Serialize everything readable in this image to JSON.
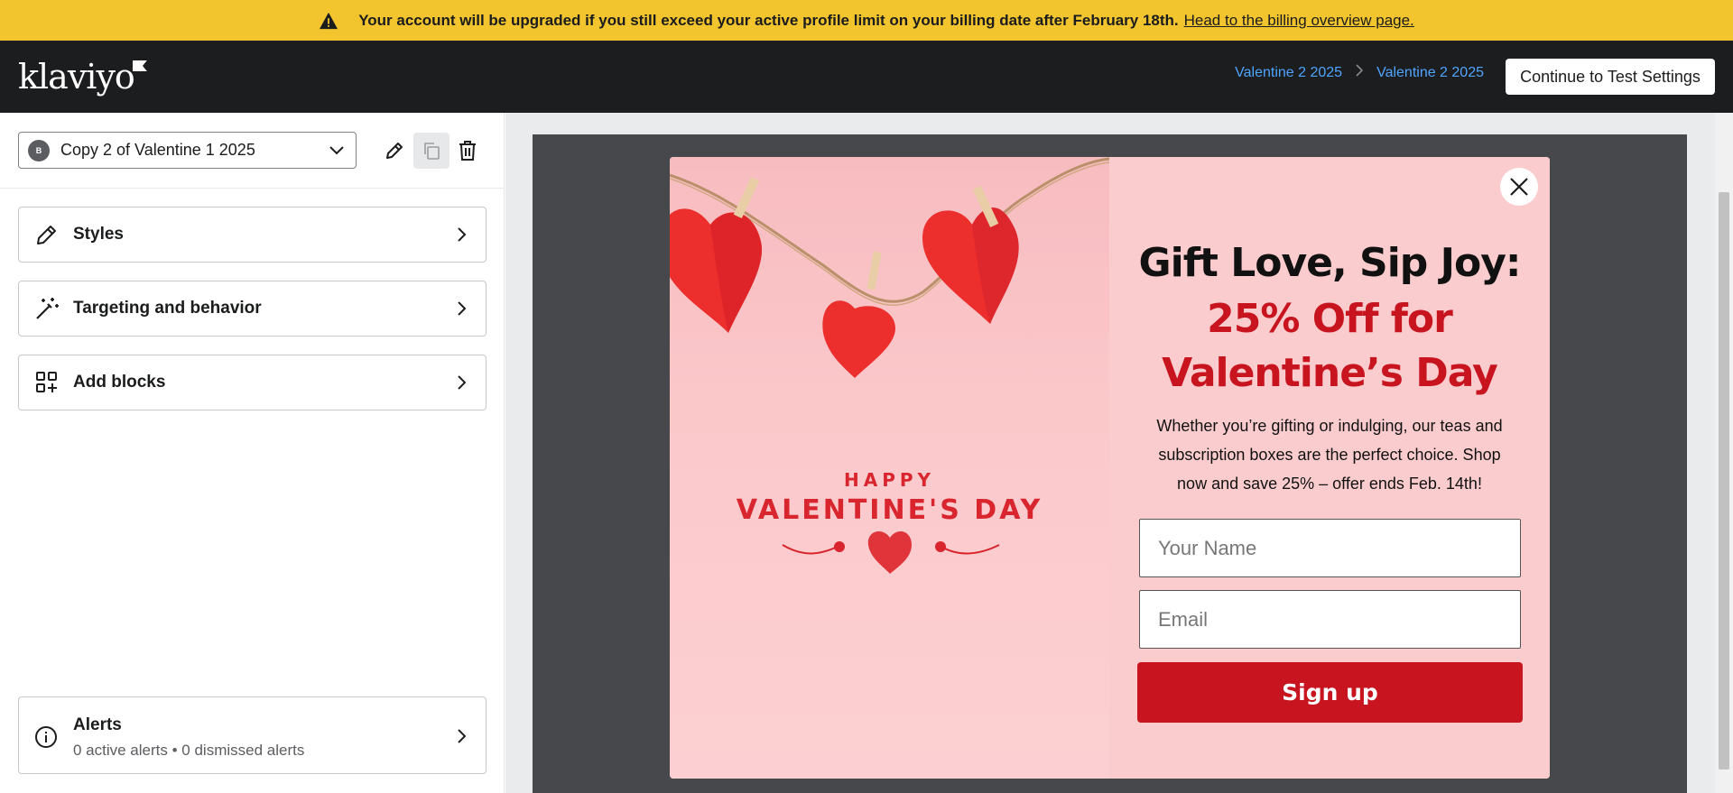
{
  "banner": {
    "message": "Your account will be upgraded if you still exceed your active profile limit on your billing date after February 18th.",
    "link": "Head to the billing overview page.",
    "icon": "warning-icon",
    "color": "#f2c42e"
  },
  "nav": {
    "logo": "klaviyo",
    "breadcrumbs": [
      "Valentine 2 2025",
      "Valentine 2 2025"
    ],
    "continue_label": "Continue to Test Settings"
  },
  "sidebar": {
    "variant": {
      "badge": "B",
      "name": "Copy 2 of Valentine 1 2025"
    },
    "panels": [
      {
        "label": "Styles",
        "icon": "pencil-icon"
      },
      {
        "label": "Targeting and behavior",
        "icon": "magic-wand-icon"
      },
      {
        "label": "Add blocks",
        "icon": "blocks-icon"
      }
    ],
    "alerts": {
      "title": "Alerts",
      "subtitle": "0 active alerts • 0 dismissed alerts"
    }
  },
  "popup": {
    "image_happy": "HAPPY",
    "image_title": "VALENTINE'S DAY",
    "headline_line1": "Gift Love, Sip Joy:",
    "headline_line2": "25% Off for",
    "headline_line3": "Valentine’s Day",
    "body": "Whether you’re gifting or indulging, our teas and subscription boxes are the perfect choice. Shop now and save 25% – offer ends Feb. 14th!",
    "name_placeholder": "Your Name",
    "email_placeholder": "Email",
    "signup_label": "Sign up",
    "accent_color": "#c8141f"
  }
}
